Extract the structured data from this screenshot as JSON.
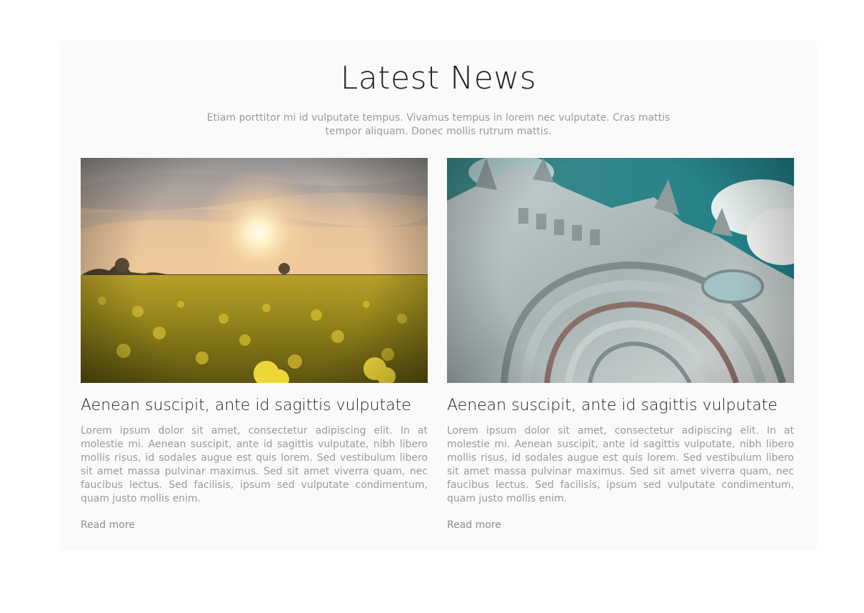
{
  "section": {
    "title": "Latest News",
    "intro": "Etiam porttitor mi id vulputate tempus. Vivamus tempus in lorem nec vulputate. Cras mattis tempor aliquam. Donec mollis rutrum mattis."
  },
  "articles": [
    {
      "image": "field-sunset-image",
      "title": "Aenean suscipit, ante id sagittis vulputate",
      "excerpt": "Lorem ipsum dolor sit amet, consectetur adipiscing elit. In at molestie mi. Aenean suscipit, ante id sagittis vulputate, nibh libero mollis risus, id sodales augue est quis lorem. Sed vestibulum libero sit amet massa pulvinar maximus. Sed sit amet viverra quam, nec faucibus lectus. Sed facilisis, ipsum sed vulputate condimentum, quam justo mollis enim.",
      "link_label": "Read more"
    },
    {
      "image": "cathedral-facade-image",
      "title": "Aenean suscipit, ante id sagittis vulputate",
      "excerpt": "Lorem ipsum dolor sit amet, consectetur adipiscing elit. In at molestie mi. Aenean suscipit, ante id sagittis vulputate, nibh libero mollis risus, id sodales augue est quis lorem. Sed vestibulum libero sit amet massa pulvinar maximus. Sed sit amet viverra quam, nec faucibus lectus. Sed facilisis, ipsum sed vulputate condimentum, quam justo mollis enim.",
      "link_label": "Read more"
    }
  ],
  "colors": {
    "background": "#ffffff",
    "panel": "#fafafa",
    "heading": "#1e1e1e",
    "body_text": "#9a9a9a"
  }
}
